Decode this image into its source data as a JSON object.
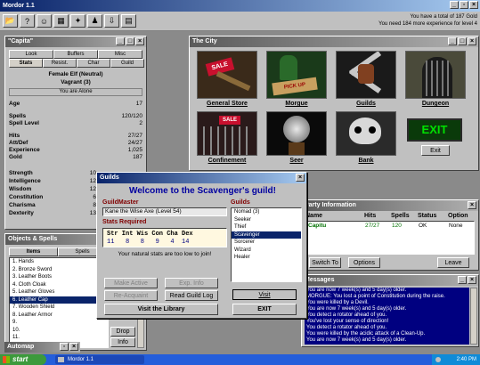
{
  "app": {
    "title": "Mordor 1.1"
  },
  "status": {
    "line1": "You have a total of 187 Gold",
    "line2": "You need 184 more experience for level 4"
  },
  "toolbar": {
    "icons": [
      "folder-icon",
      "help-icon",
      "party-icon",
      "map-icon",
      "spells-icon",
      "team-icon",
      "import-icon",
      "export-icon"
    ]
  },
  "character": {
    "title": "\"Capita\"",
    "tabs_row1": [
      "Look",
      "Buffers",
      "Misc"
    ],
    "tabs_row2": [
      "Stats",
      "Resist.",
      "Char",
      "Guild"
    ],
    "race": "Female Elf (Neutral)",
    "rank": "Vagrant (3)",
    "alone": "You are Alone",
    "stats": [
      {
        "label": "Age",
        "value": "17"
      },
      {
        "label": "Spells",
        "value": "120/120"
      },
      {
        "label": "Spell Level",
        "value": "2"
      },
      {
        "label": "Hits",
        "value": "27/27"
      },
      {
        "label": "Att/Def",
        "value": "24/27"
      },
      {
        "label": "Experience",
        "value": "1,025"
      },
      {
        "label": "Gold",
        "value": "187"
      }
    ],
    "attrs": [
      {
        "label": "Strength",
        "value": "10"
      },
      {
        "label": "Intelligence",
        "value": "12"
      },
      {
        "label": "Wisdom",
        "value": "12"
      },
      {
        "label": "Constitution",
        "value": "6"
      },
      {
        "label": "Charisma",
        "value": "8"
      },
      {
        "label": "Dexterity",
        "value": "13"
      }
    ]
  },
  "objects": {
    "title": "Objects & Spells",
    "tab_items": "Items",
    "tab_spells": "Spells",
    "items": [
      "1. Hands",
      "2. Bronze Sword",
      "3. Leather Boots",
      "4. Cloth Cloak",
      "5. Leather Gloves",
      "6. Leather Cap",
      "7. Wooden Shield",
      "8. Leather Armor",
      "9.",
      "10.",
      "11."
    ],
    "drop": "Drop",
    "info": "Info"
  },
  "automap": {
    "title": "Automap"
  },
  "city": {
    "title": "The City",
    "places": [
      {
        "label": "General Store"
      },
      {
        "label": "Morgue"
      },
      {
        "label": "Guilds"
      },
      {
        "label": "Dungeon"
      },
      {
        "label": "Confinement"
      },
      {
        "label": "Seer"
      },
      {
        "label": "Bank"
      },
      {
        "label": "Exit"
      }
    ],
    "sign_sale": "SALE",
    "sign_pickup": "PICK UP",
    "sign_exit": "EXIT"
  },
  "guild": {
    "title": "Guilds",
    "welcome": "Welcome to the Scavenger's guild!",
    "master_label": "GuildMaster",
    "master_name": "Kane the Wise Axe (Level 54)",
    "req_label": "Stats Required",
    "req_header": "Str Int Wis Con Cha Dex",
    "req_values": "11   8   8   9   4  14",
    "note": "Your natural stats are too low to join!",
    "guilds_label": "Guilds",
    "guild_list": [
      "Nomad (3)",
      "Seeker",
      "Thief",
      "Scavenger",
      "Sorcerer",
      "Wizard",
      "Healer"
    ],
    "selected": 3,
    "make_active": "Make Active",
    "exp_info": "Exp. Info",
    "re_acquaint": "Re-Acquaint",
    "read_log": "Read Guild Log",
    "visit_library": "Visit the Library",
    "visit": "Visit",
    "exit": "EXIT"
  },
  "party": {
    "title": "Party Information",
    "headers": [
      "Name",
      "Hits",
      "Spells",
      "Status",
      "Option"
    ],
    "rows": [
      {
        "name": "Capitu",
        "hits": "27/27",
        "spells": "120",
        "status": "OK",
        "option": "None"
      }
    ],
    "switch_to": "Switch To",
    "options": "Options",
    "leave": "Leave"
  },
  "messages": {
    "title": "Messages",
    "lines": [
      "You are now 7 week(s) and 5 day(s) older.",
      "MORGUE: You lost a point of Constitution during the raise.",
      "You were killed by a Devil.",
      "You are now 7 week(s) and 5 day(s) older.",
      "You detect a rotator ahead of you.",
      "You've lost your sense of direction!",
      "You detect a rotator ahead of you.",
      "You were killed by the acidic attack of a Clean-Up.",
      "You are now 7 week(s) and 5 day(s) older."
    ]
  },
  "taskbar": {
    "start": "start",
    "task": "Mordor 1.1",
    "clock": "2:40 PM"
  }
}
